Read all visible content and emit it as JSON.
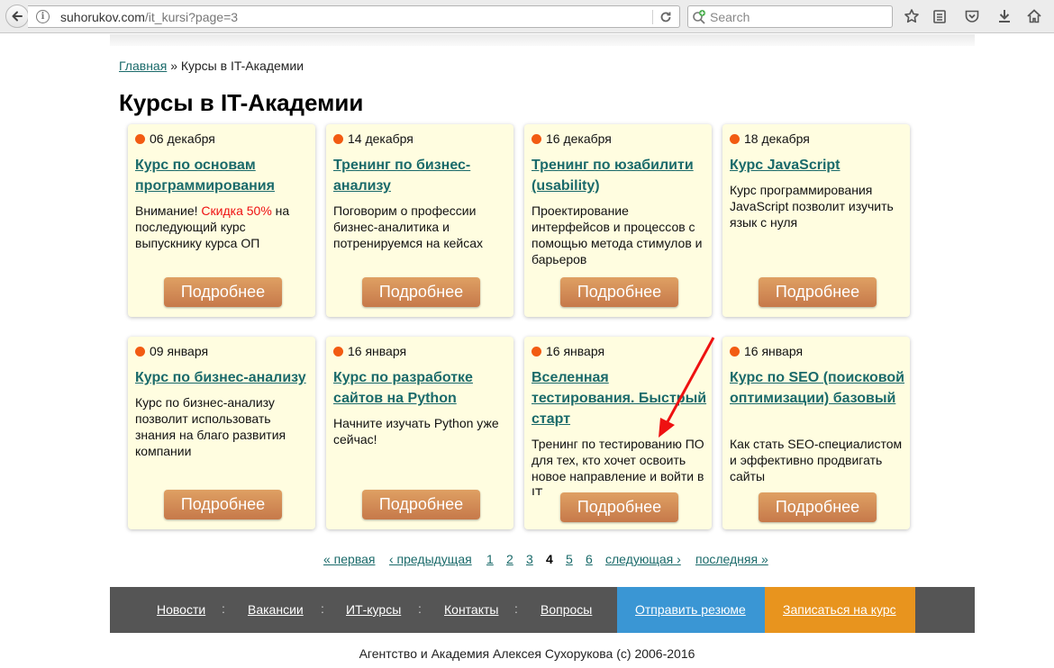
{
  "browser": {
    "url_host": "suhorukov.com",
    "url_path": "/it_kursi?page=3",
    "search_placeholder": "Search"
  },
  "breadcrumb": {
    "home": "Главная",
    "separator": "»",
    "current": "Курсы в IT-Академии"
  },
  "page_title": "Курсы в IT-Академии",
  "more_label": "Подробнее",
  "cards": [
    {
      "date": "06 декабря",
      "title": "Курс по основам программирования",
      "desc_before": "Внимание! ",
      "desc_red": "Скидка 50%",
      "desc_after": " на последующий курс выпускнику курса ОП"
    },
    {
      "date": "14 декабря",
      "title": "Тренинг по бизнес-анализу",
      "desc": "Поговорим о профессии бизнес-аналитика и потренируемся на кейсах"
    },
    {
      "date": "16 декабря",
      "title": "Тренинг по юзабилити (usability)",
      "desc": "Проектирование интерфейсов и процессов с помощью метода стимулов и барьеров"
    },
    {
      "date": "18 декабря",
      "title": "Курс JavaScript",
      "desc": "Курс программирования JavaScript позволит изучить язык с нуля"
    },
    {
      "date": "09 января",
      "title": "Курс по бизнес-анализу",
      "desc": "Курс по бизнес-анализу позволит использовать знания на благо развития компании"
    },
    {
      "date": "16 января",
      "title": "Курс по разработке сайтов на Python",
      "desc": "Начните изучать Python уже сейчас!"
    },
    {
      "date": "16 января",
      "title": "Вселенная тестирования. Быстрый старт",
      "desc": "Тренинг по тестированию ПО для тех, кто хочет освоить новое направление и войти в IT"
    },
    {
      "date": "16 января",
      "title": "Курс по SEO (поисковой оптимизации) базовый",
      "desc": "Как стать SEO-специалистом и эффективно продвигать сайты"
    }
  ],
  "pager": {
    "first": "« первая",
    "prev": "‹ предыдущая",
    "pages": [
      "1",
      "2",
      "3",
      "4",
      "5",
      "6"
    ],
    "current": "4",
    "next": "следующая ›",
    "last": "последняя »"
  },
  "footer": {
    "links": [
      "Новости",
      "Вакансии",
      "ИТ-курсы",
      "Контакты",
      "Вопросы"
    ],
    "separator": ":",
    "send_resume": "Отправить резюме",
    "enroll": "Записаться на курс",
    "copyright": "Агентство и Академия Алексея Сухорукова (с) 2006-2016"
  },
  "colors": {
    "card_bg": "#fffde0",
    "link": "#1a6a6a",
    "accent_dot": "#f25b12",
    "button": "#d08b55",
    "footer_bg": "#555555",
    "footer_blue": "#3a96d4",
    "footer_orange": "#e8941e",
    "annotation_arrow": "#ee1111"
  },
  "icons": [
    "back-arrow-icon",
    "info-icon",
    "reload-icon",
    "search-engine-icon",
    "bookmark-star-icon",
    "reader-icon",
    "pocket-icon",
    "download-icon",
    "home-icon",
    "menu-icon",
    "annotation-arrow"
  ]
}
